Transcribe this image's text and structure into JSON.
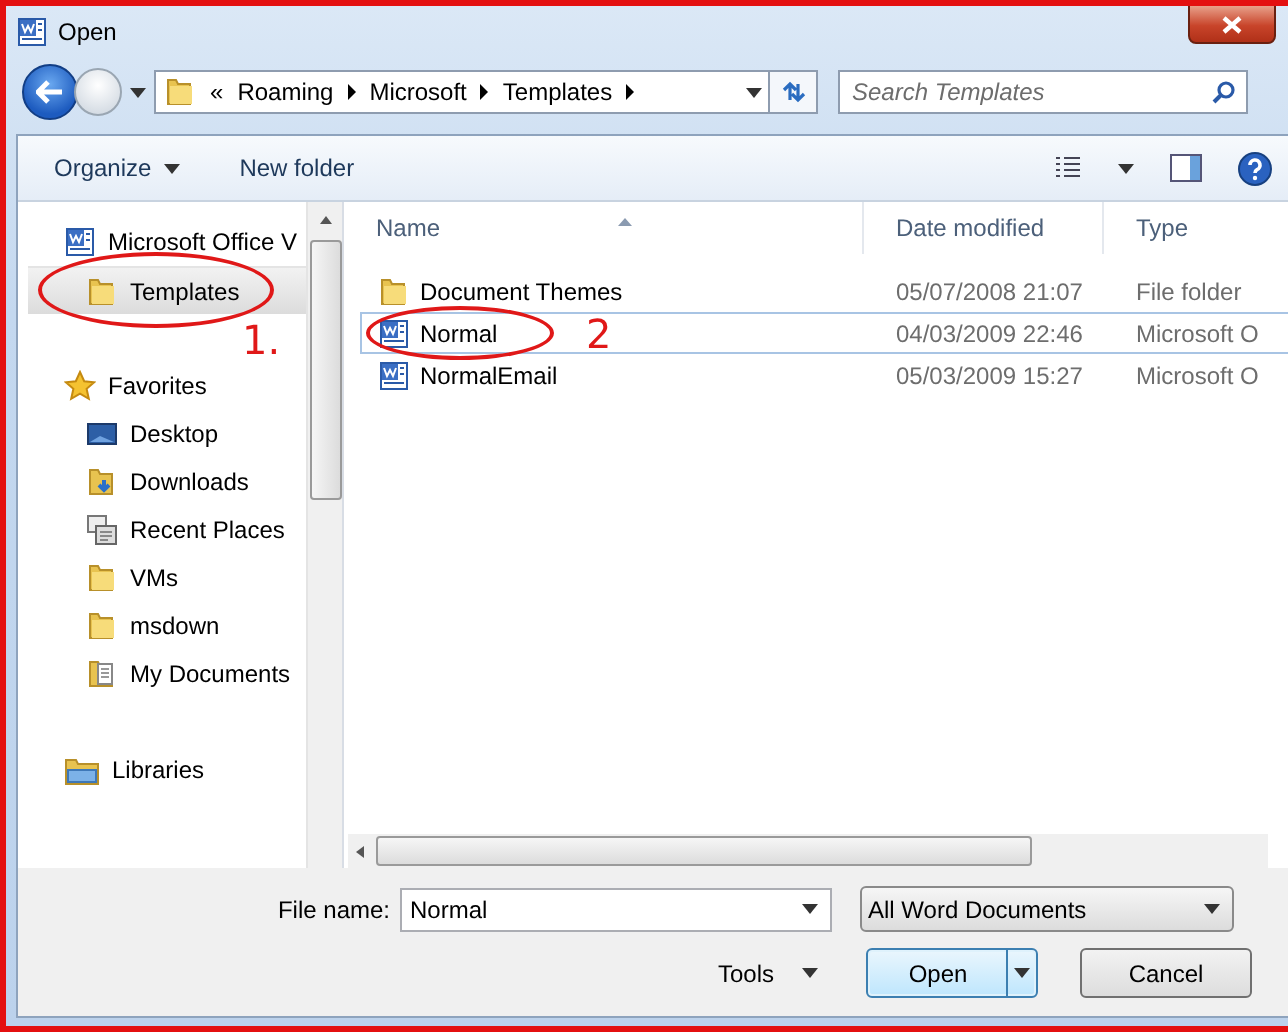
{
  "window": {
    "title": "Open"
  },
  "address": {
    "overflow": "«",
    "crumbs": [
      "Roaming",
      "Microsoft",
      "Templates"
    ]
  },
  "search": {
    "placeholder": "Search Templates"
  },
  "toolbar": {
    "organize": "Organize",
    "new_folder": "New folder"
  },
  "sidebar": {
    "groups": [
      {
        "label": "Microsoft Office V",
        "kind": "word",
        "selected": false,
        "children": [
          {
            "label": "Templates",
            "kind": "folder",
            "selected": true,
            "annotation": "1."
          }
        ]
      },
      {
        "label": "Favorites",
        "kind": "star",
        "selected": false,
        "children": [
          {
            "label": "Desktop",
            "kind": "desktop",
            "selected": false
          },
          {
            "label": "Downloads",
            "kind": "downloads",
            "selected": false
          },
          {
            "label": "Recent Places",
            "kind": "recent",
            "selected": false
          },
          {
            "label": "VMs",
            "kind": "folder",
            "selected": false
          },
          {
            "label": "msdown",
            "kind": "folder",
            "selected": false
          },
          {
            "label": "My Documents",
            "kind": "documents",
            "selected": false
          }
        ]
      },
      {
        "label": "Libraries",
        "kind": "library",
        "selected": false
      }
    ]
  },
  "file_list": {
    "columns": [
      "Name",
      "Date modified",
      "Type"
    ],
    "rows": [
      {
        "name": "Document Themes",
        "date": "05/07/2008 21:07",
        "type": "File folder",
        "kind": "folder",
        "selected": false
      },
      {
        "name": "Normal",
        "date": "04/03/2009 22:46",
        "type": "Microsoft O",
        "kind": "word",
        "selected": true,
        "annotation": "2"
      },
      {
        "name": "NormalEmail",
        "date": "05/03/2009 15:27",
        "type": "Microsoft O",
        "kind": "word",
        "selected": false
      }
    ]
  },
  "footer": {
    "file_name_label": "File name:",
    "file_name": "Normal",
    "file_type": "All Word Documents",
    "tools": "Tools",
    "open": "Open",
    "cancel": "Cancel"
  }
}
